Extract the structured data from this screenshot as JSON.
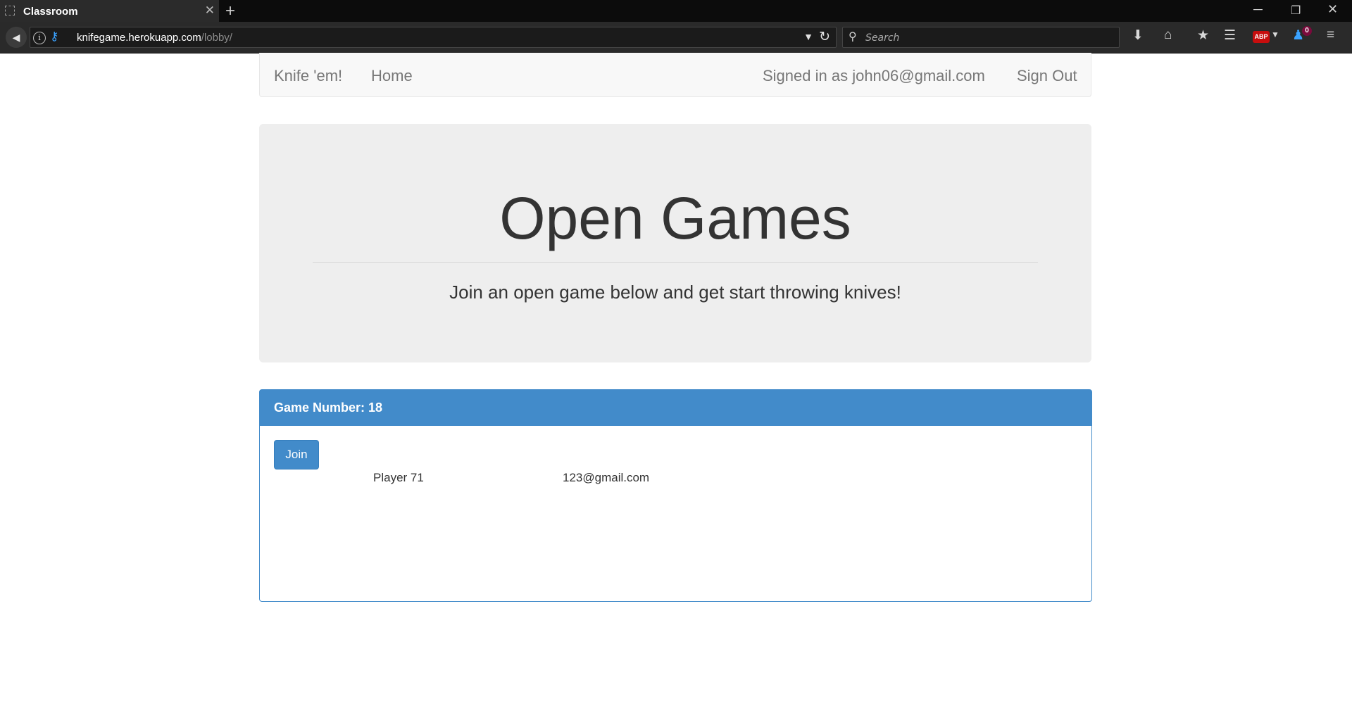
{
  "browser": {
    "tab_title": "Classroom",
    "url_host": "knifegame.herokuapp.com",
    "url_path": "/lobby/",
    "search_placeholder": "Search",
    "notification_count": "0",
    "adblock_label": "ABP"
  },
  "navbar": {
    "brand": "Knife 'em!",
    "home": "Home",
    "signed_in": "Signed in as john06@gmail.com",
    "sign_out": "Sign Out"
  },
  "jumbotron": {
    "title": "Open Games",
    "subtitle": "Join an open game below and get start throwing knives!"
  },
  "games": [
    {
      "heading": "Game Number: 18",
      "join_label": "Join",
      "player_name": "Player 71",
      "player_email": "123@gmail.com"
    }
  ],
  "colors": {
    "primary": "#428bca",
    "jumbotron_bg": "#eeeeee",
    "navbar_bg": "#f8f8f8",
    "chrome_bg": "#2a2a2a"
  },
  "icons": [
    "page-icon",
    "close-tab-icon",
    "new-tab-icon",
    "back-arrow-icon",
    "info-icon",
    "key-icon",
    "dropdown-icon",
    "reload-icon",
    "search-icon",
    "download-icon",
    "home-icon",
    "bookmark-star-icon",
    "reading-list-icon",
    "adblock-icon",
    "notification-icon",
    "menu-icon"
  ]
}
